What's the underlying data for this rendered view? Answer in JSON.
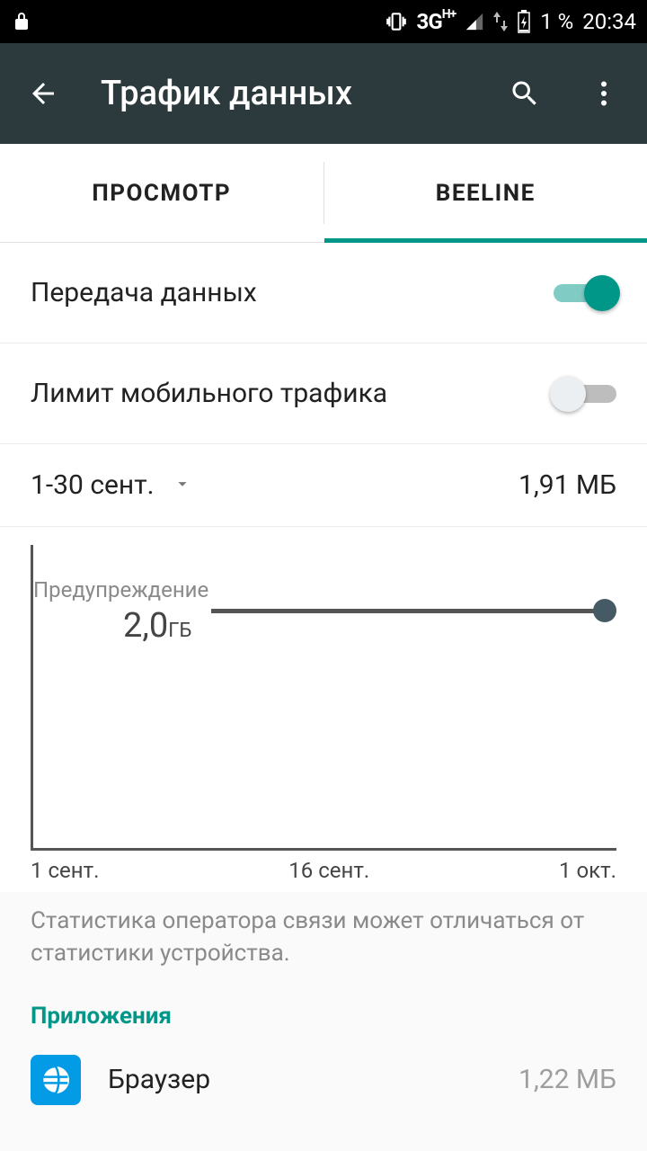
{
  "statusbar": {
    "battery_text": "1 %",
    "clock": "20:34",
    "network_label": "3G",
    "network_sup": "H+"
  },
  "toolbar": {
    "title": "Трафик данных"
  },
  "tabs": [
    "ПРОСМОТР",
    "BEELINE"
  ],
  "settings": {
    "data_transfer_label": "Передача данных",
    "data_transfer_on": true,
    "data_limit_label": "Лимит мобильного трафика",
    "data_limit_on": false
  },
  "period": {
    "range": "1-30 сент.",
    "usage_total": "1,91 МБ"
  },
  "chart": {
    "warning_label": "Предупреждение",
    "warning_value": "2,0",
    "warning_unit": "ГБ",
    "ticks": [
      "1 сент.",
      "16 сент.",
      "1 окт."
    ],
    "note": "Статистика оператора связи может отличаться от статистики устройства."
  },
  "apps_section_title": "Приложения",
  "apps": [
    {
      "name": "Браузер",
      "usage": "1,22 МБ"
    }
  ],
  "chart_data": {
    "type": "line",
    "title": "",
    "xlabel": "",
    "ylabel": "",
    "x": [
      "1 сент.",
      "16 сент.",
      "1 окт."
    ],
    "series": [
      {
        "name": "usage_GB",
        "values": [
          0,
          0,
          0
        ]
      },
      {
        "name": "warning_level_GB",
        "values": [
          2.0,
          2.0,
          2.0
        ]
      }
    ],
    "ylim": [
      0,
      2.2
    ]
  }
}
